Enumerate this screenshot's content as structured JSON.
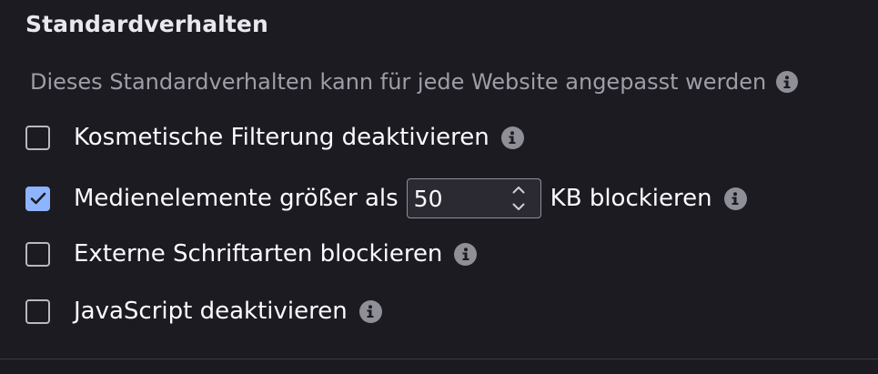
{
  "section": {
    "title": "Standardverhalten",
    "description": "Dieses Standardverhalten kann für jede Website angepasst werden"
  },
  "options": [
    {
      "label": "Kosmetische Filterung deaktivieren",
      "checked": false
    },
    {
      "label_before": "Medienelemente größer als",
      "value": "50",
      "label_after": "KB blockieren",
      "checked": true
    },
    {
      "label": "Externe Schriftarten blockieren",
      "checked": false
    },
    {
      "label": "JavaScript deaktivieren",
      "checked": false
    }
  ],
  "icons": {
    "info": "info-icon",
    "checkmark": "checkmark-icon",
    "spinner_up": "chevron-up-icon",
    "spinner_down": "chevron-down-icon"
  },
  "colors": {
    "background": "#1c1b22",
    "accent": "#8fb4ff",
    "text": "#fbfbfe",
    "muted_text": "#9e9ea8",
    "info_icon": "#8f8f97"
  }
}
